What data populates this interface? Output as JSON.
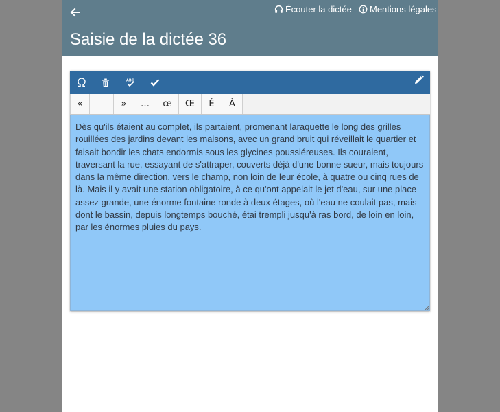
{
  "header": {
    "back_icon": "arrow-left-icon",
    "listen_label": "Écouter la dictée",
    "listen_icon": "headphones-icon",
    "legal_label": "Mentions légales",
    "legal_icon": "info-circle-icon",
    "title": "Saisie de la dictée 36",
    "color": "#5f7d8c"
  },
  "editor": {
    "toolbar_color": "#2f6aa0",
    "toolbar_icons": [
      "omega-icon",
      "trash-icon",
      "spellcheck-icon",
      "check-icon",
      "pencil-icon"
    ],
    "special_chars": [
      "«",
      "—",
      "»",
      "…",
      "œ",
      "Œ",
      "É",
      "À"
    ],
    "text": "Dès qu'ils étaient au complet, ils partaient, promenant laraquette le long des grilles rouillées des jardins devant les maisons, avec un grand bruit qui réveillait le quartier et faisait bondir les chats endormis sous les glycines poussiéreuses. Ils couraient, traversant la rue, essayant de s'attraper, couverts déjà d'une bonne sueur, mais toujours dans la même direction, vers le champ, non loin de leur école, à quatre ou cinq rues de là. Mais il y avait une station obligatoire, à ce qu'ont appelait le jet d'eau, sur une place assez grande, une énorme fontaine ronde à deux étages, où l'eau ne coulait pas, mais dont le bassin, depuis longtemps bouché, étai trempli jusqu'à ras bord, de loin en loin, par les énormes pluies du pays.",
    "text_background": "#90c8f8"
  }
}
